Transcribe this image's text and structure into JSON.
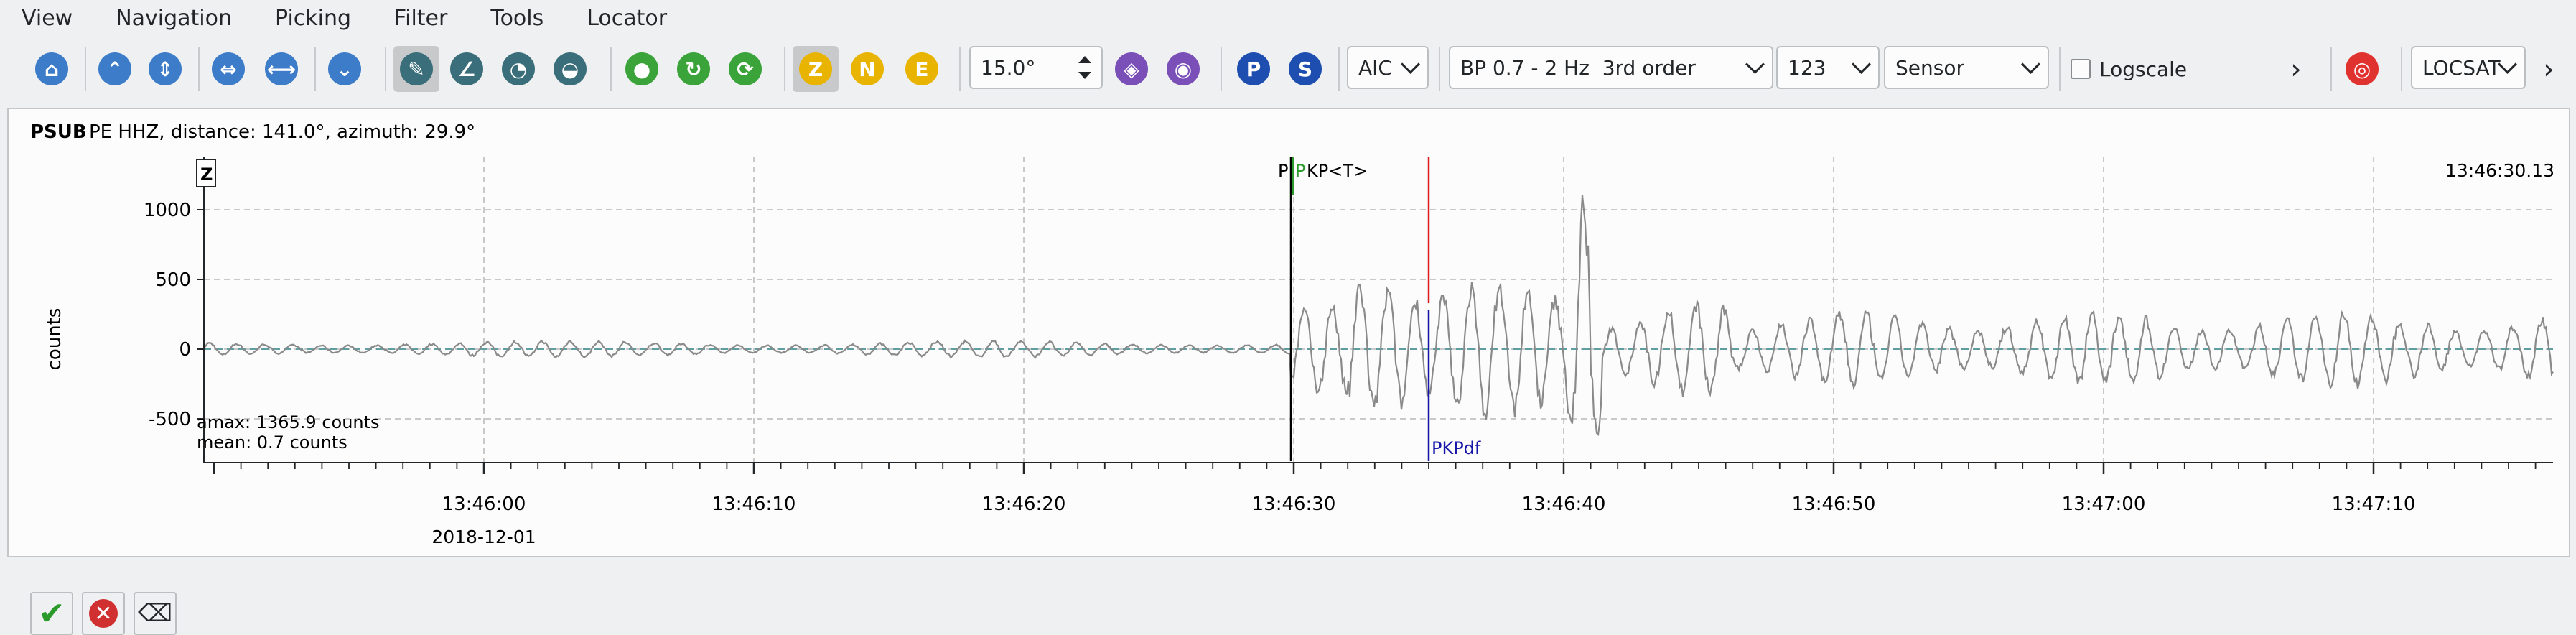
{
  "menu": [
    "View",
    "Navigation",
    "Picking",
    "Filter",
    "Tools",
    "Locator"
  ],
  "toolbar": {
    "zoom_value": "15.0°",
    "picker_method": "AIC",
    "filter": "BP 0.7 - 2 Hz  3rd order",
    "component_set": "123",
    "unit_mode": "Sensor",
    "logscale_label": "Logscale",
    "logscale_checked": false,
    "locator": "LOCSAT",
    "buttons": {
      "z": "Z",
      "n": "N",
      "e": "E",
      "p": "P",
      "s": "S"
    },
    "overflow_glyph": "›"
  },
  "trace": {
    "station": "PSUB",
    "info": "PE  HHZ, distance: 141.0°, azimuth: 29.9°",
    "component_box": "Z",
    "y_axis_label": "counts",
    "y_ticks": [
      "1000",
      "500",
      "0",
      "-500"
    ],
    "x_ticks": [
      "13:46:00",
      "13:46:10",
      "13:46:20",
      "13:46:30",
      "13:46:40",
      "13:46:50",
      "13:47:00",
      "13:47:10"
    ],
    "date": "2018-12-01",
    "time_readout": "13:46:30.13",
    "amax": "amax: 1365.9 counts",
    "mean": "mean: 0.7 counts",
    "picks": {
      "p_black": "P",
      "p_green": "P",
      "pkp": "KP<T>",
      "pkpdf": "PKPdf"
    },
    "colors": {
      "trace": "#8a8a8a",
      "zero_line": "#5f9ea0",
      "pick_black": "#000000",
      "pick_green": "#2e9a2e",
      "pick_red": "#e01b1b",
      "pick_blue": "#1515a8",
      "grid": "#b8b8b8"
    }
  }
}
